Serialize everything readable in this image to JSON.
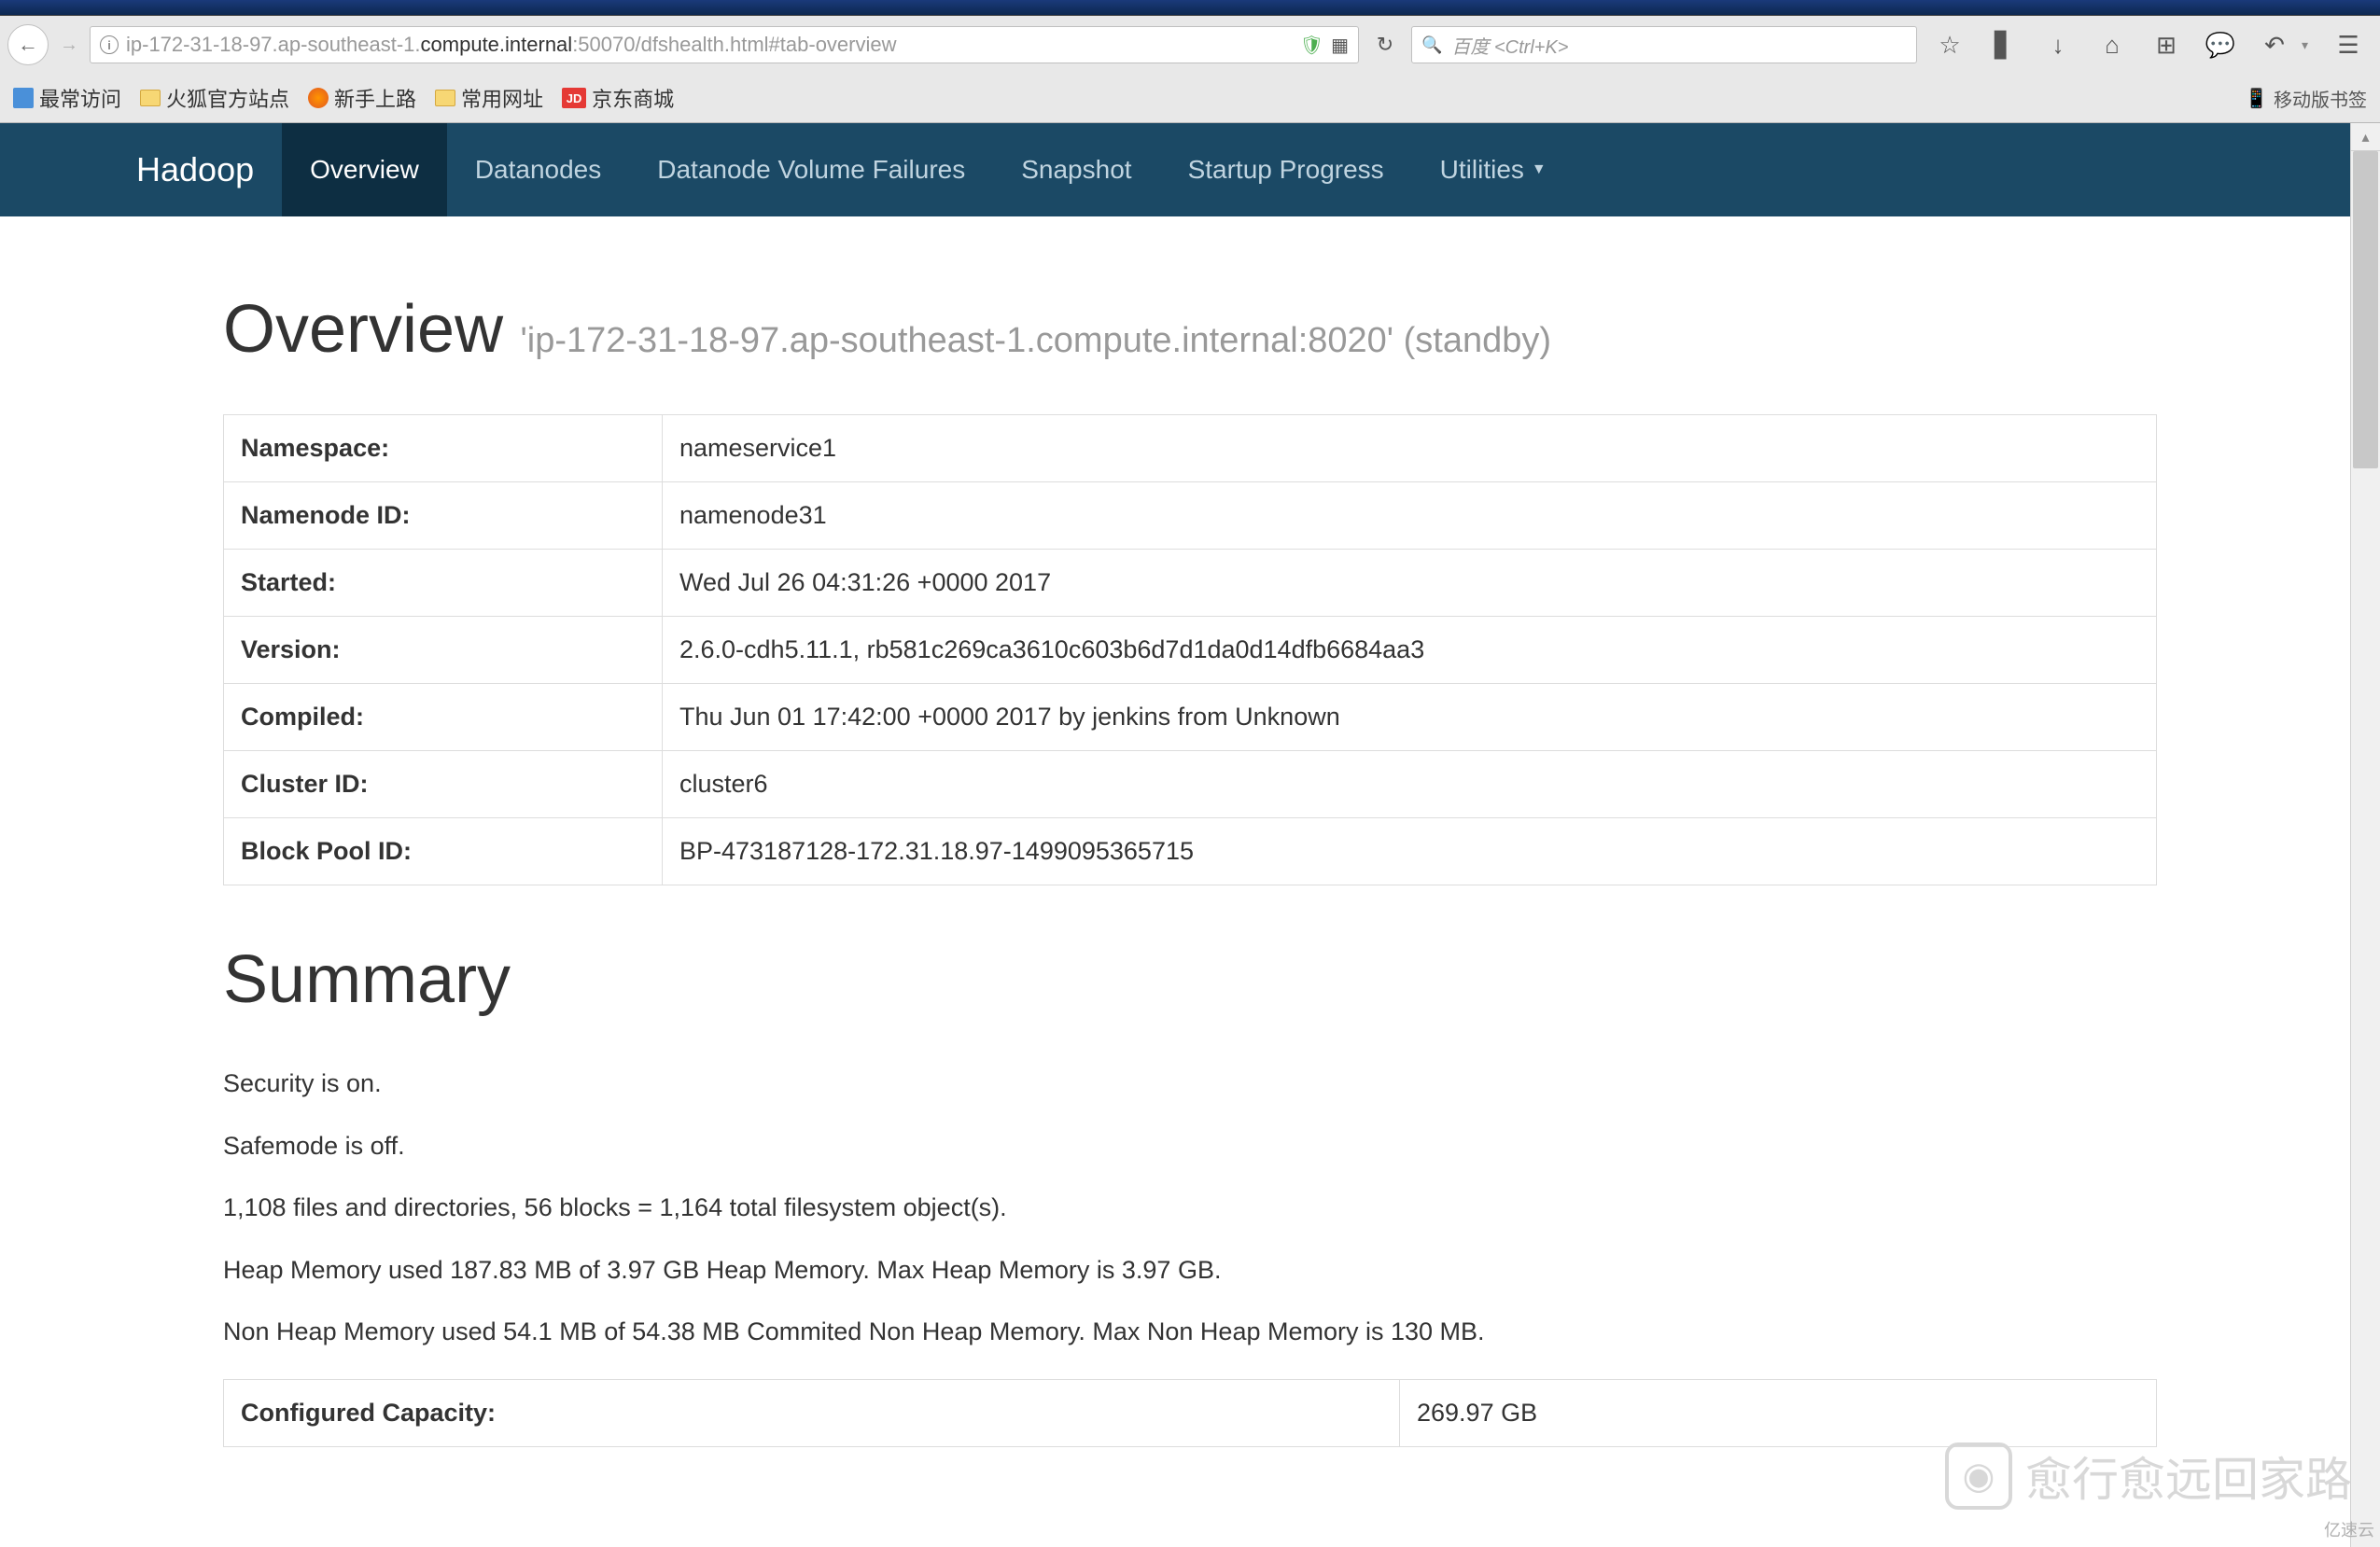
{
  "browser": {
    "url_prefix": "ip-172-31-18-97.ap-southeast-1.",
    "url_bold": "compute.internal",
    "url_suffix": ":50070/dfshealth.html#tab-overview",
    "search_placeholder": "百度 <Ctrl+K>",
    "bookmarks": {
      "most_visited": "最常访问",
      "firefox_official": "火狐官方站点",
      "getting_started": "新手上路",
      "common_urls": "常用网址",
      "jd_label": "JD",
      "jd_mall": "京东商城",
      "mobile_bookmarks": "移动版书签"
    }
  },
  "navbar": {
    "brand": "Hadoop",
    "items": [
      "Overview",
      "Datanodes",
      "Datanode Volume Failures",
      "Snapshot",
      "Startup Progress",
      "Utilities"
    ]
  },
  "overview": {
    "title": "Overview",
    "subtitle": "'ip-172-31-18-97.ap-southeast-1.compute.internal:8020' (standby)",
    "rows": [
      {
        "label": "Namespace:",
        "value": "nameservice1"
      },
      {
        "label": "Namenode ID:",
        "value": "namenode31"
      },
      {
        "label": "Started:",
        "value": "Wed Jul 26 04:31:26 +0000 2017"
      },
      {
        "label": "Version:",
        "value": "2.6.0-cdh5.11.1, rb581c269ca3610c603b6d7d1da0d14dfb6684aa3"
      },
      {
        "label": "Compiled:",
        "value": "Thu Jun 01 17:42:00 +0000 2017 by jenkins from Unknown"
      },
      {
        "label": "Cluster ID:",
        "value": "cluster6"
      },
      {
        "label": "Block Pool ID:",
        "value": "BP-473187128-172.31.18.97-1499095365715"
      }
    ]
  },
  "summary": {
    "title": "Summary",
    "lines": [
      "Security is on.",
      "Safemode is off.",
      "1,108 files and directories, 56 blocks = 1,164 total filesystem object(s).",
      "Heap Memory used 187.83 MB of 3.97 GB Heap Memory. Max Heap Memory is 3.97 GB.",
      "Non Heap Memory used 54.1 MB of 54.38 MB Commited Non Heap Memory. Max Non Heap Memory is 130 MB."
    ],
    "table": [
      {
        "label": "Configured Capacity:",
        "value": "269.97 GB"
      }
    ]
  },
  "watermark": {
    "text": "愈行愈远回家路",
    "corner": "亿速云"
  }
}
